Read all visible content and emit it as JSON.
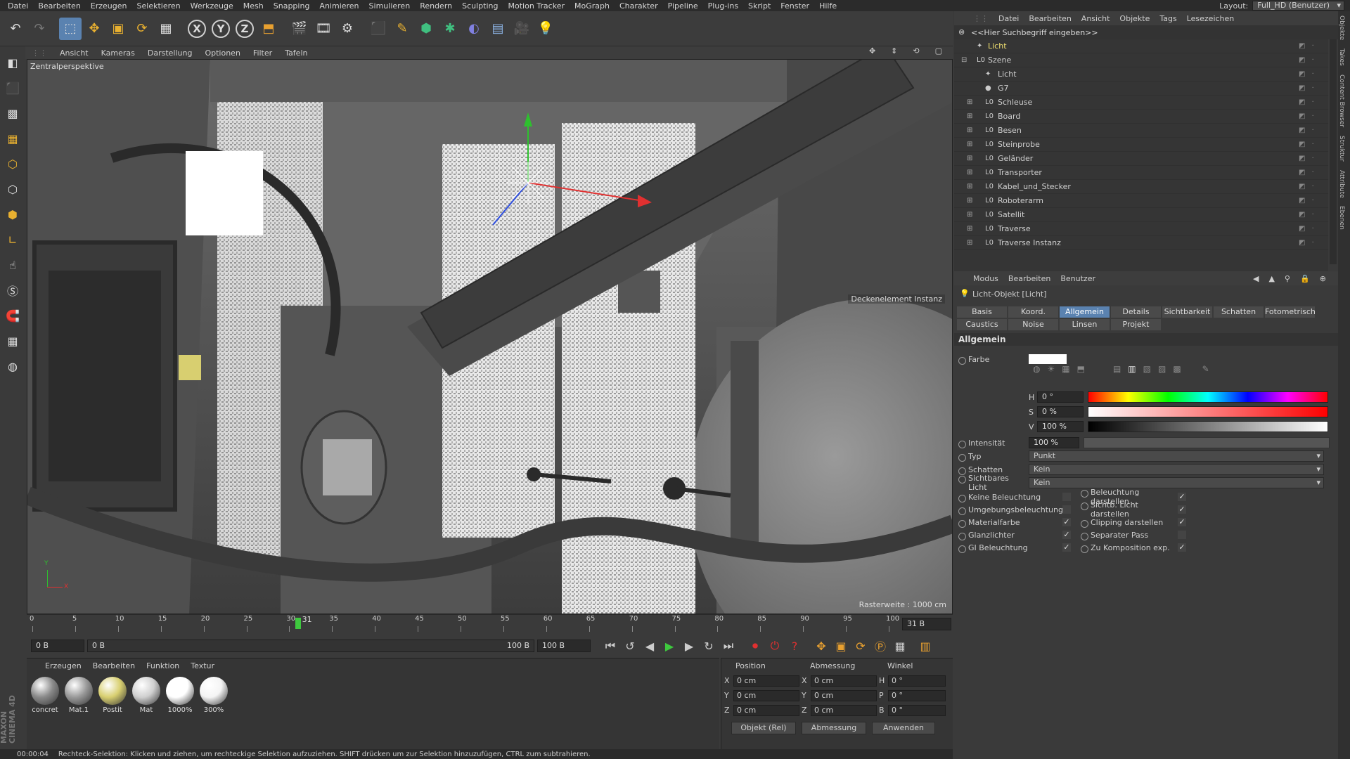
{
  "menubar": {
    "items": [
      "Datei",
      "Bearbeiten",
      "Erzeugen",
      "Selektieren",
      "Werkzeuge",
      "Mesh",
      "Snapping",
      "Animieren",
      "Simulieren",
      "Rendern",
      "Sculpting",
      "Motion Tracker",
      "MoGraph",
      "Charakter",
      "Pipeline",
      "Plug-ins",
      "Skript",
      "Fenster",
      "Hilfe"
    ],
    "layout_label": "Layout:",
    "layout_value": "Full_HD (Benutzer)"
  },
  "toolbar": {
    "axis_x": "X",
    "axis_y": "Y",
    "axis_z": "Z"
  },
  "viewport": {
    "menu": [
      "Ansicht",
      "Kameras",
      "Darstellung",
      "Optionen",
      "Filter",
      "Tafeln"
    ],
    "label": "Zentralperspektive",
    "tooltip": "Deckenelement Instanz",
    "raster": "Rasterweite : 1000 cm",
    "axis_x": "X",
    "axis_y": "Y"
  },
  "timeline": {
    "ticks": [
      "0",
      "5",
      "10",
      "15",
      "20",
      "25",
      "30",
      "35",
      "40",
      "45",
      "50",
      "55",
      "60",
      "65",
      "70",
      "75",
      "80",
      "85",
      "90",
      "95",
      "100"
    ],
    "current": "31",
    "end_field": "31 B",
    "current_frac": 0.31
  },
  "playback": {
    "start": "0 B",
    "range_start": "0 B",
    "range_end": "100 B",
    "end": "100 B"
  },
  "materials": {
    "menu": [
      "Erzeugen",
      "Bearbeiten",
      "Funktion",
      "Textur"
    ],
    "items": [
      {
        "label": "concret",
        "color": "#8a8a8a"
      },
      {
        "label": "Mat.1",
        "color": "#9a9a9a"
      },
      {
        "label": "Postit",
        "color": "#d8cf70"
      },
      {
        "label": "Mat",
        "color": "#cfcfcf"
      },
      {
        "label": "1000%",
        "color": "#ffffff"
      },
      {
        "label": "300%",
        "color": "#f4f4f4"
      }
    ],
    "brand": "MAXON",
    "product": "CINEMA 4D"
  },
  "coords": {
    "headers": [
      "Position",
      "Abmessung",
      "Winkel"
    ],
    "rows": [
      {
        "a": "X",
        "pos": "0 cm",
        "b": "X",
        "dim": "0 cm",
        "c": "H",
        "ang": "0 °"
      },
      {
        "a": "Y",
        "pos": "0 cm",
        "b": "Y",
        "dim": "0 cm",
        "c": "P",
        "ang": "0 °"
      },
      {
        "a": "Z",
        "pos": "0 cm",
        "b": "Z",
        "dim": "0 cm",
        "c": "B",
        "ang": "0 °"
      }
    ],
    "mode": "Objekt (Rel)",
    "size_mode": "Abmessung",
    "apply": "Anwenden"
  },
  "status": {
    "time": "00:00:04",
    "text": "Rechteck-Selektion: Klicken und ziehen, um rechteckige Selektion aufzuziehen. SHIFT drücken um zur Selektion hinzuzufügen, CTRL zum subtrahieren."
  },
  "objects": {
    "menu": [
      "Datei",
      "Bearbeiten",
      "Ansicht",
      "Objekte",
      "Tags",
      "Lesezeichen"
    ],
    "search_placeholder": "<<Hier Suchbegriff eingeben>>",
    "items": [
      {
        "name": "Licht",
        "level": 0,
        "hl": true
      },
      {
        "name": "Szene",
        "level": 0,
        "hl": false
      },
      {
        "name": "Licht",
        "level": 1,
        "hl": false
      },
      {
        "name": "G7",
        "level": 1,
        "hl": false
      },
      {
        "name": "Schleuse",
        "level": 1,
        "hl": false
      },
      {
        "name": "Board",
        "level": 1,
        "hl": false
      },
      {
        "name": "Besen",
        "level": 1,
        "hl": false
      },
      {
        "name": "Steinprobe",
        "level": 1,
        "hl": false
      },
      {
        "name": "Geländer",
        "level": 1,
        "hl": false
      },
      {
        "name": "Transporter",
        "level": 1,
        "hl": false
      },
      {
        "name": "Kabel_und_Stecker",
        "level": 1,
        "hl": false
      },
      {
        "name": "Roboterarm",
        "level": 1,
        "hl": false
      },
      {
        "name": "Satellit",
        "level": 1,
        "hl": false
      },
      {
        "name": "Traverse",
        "level": 1,
        "hl": false
      },
      {
        "name": "Traverse Instanz",
        "level": 1,
        "hl": false
      }
    ]
  },
  "side_tabs": [
    "Objekte",
    "Takes",
    "Content Browser",
    "Struktur",
    "Attribute",
    "Ebenen"
  ],
  "attributes": {
    "menu": [
      "Modus",
      "Bearbeiten",
      "Benutzer"
    ],
    "title": "Licht-Objekt [Licht]",
    "tabs_row1": [
      "Basis",
      "Koord.",
      "Allgemein",
      "Details",
      "Sichtbarkeit",
      "Schatten",
      "Fotometrisch"
    ],
    "tabs_row2": [
      "Caustics",
      "Noise",
      "Linsen",
      "Projekt"
    ],
    "active_tab": "Allgemein",
    "section": "Allgemein",
    "farbe_label": "Farbe",
    "h_label": "H",
    "h_value": "0 °",
    "s_label": "S",
    "s_value": "0 %",
    "v_label": "V",
    "v_value": "100 %",
    "intensity_label": "Intensität",
    "intensity_value": "100 %",
    "typ_label": "Typ",
    "typ_value": "Punkt",
    "schatten_label": "Schatten",
    "schatten_value": "Kein",
    "sichtbar_label": "Sichtbares Licht",
    "sichtbar_value": "Kein",
    "checks_left": [
      {
        "label": "Keine Beleuchtung",
        "on": false
      },
      {
        "label": "Umgebungsbeleuchtung",
        "on": false
      },
      {
        "label": "Materialfarbe",
        "on": true
      },
      {
        "label": "Glanzlichter",
        "on": true
      },
      {
        "label": "GI Beleuchtung",
        "on": true
      }
    ],
    "checks_right": [
      {
        "label": "Beleuchtung darstellen",
        "on": true
      },
      {
        "label": "Sichtb. Licht darstellen",
        "on": true
      },
      {
        "label": "Clipping darstellen",
        "on": true
      },
      {
        "label": "Separater Pass",
        "on": false
      },
      {
        "label": "Zu Komposition exp.",
        "on": true
      }
    ]
  }
}
